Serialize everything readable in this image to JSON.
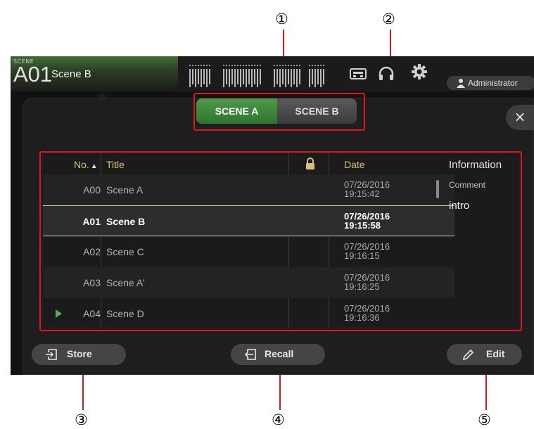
{
  "callouts": [
    "①",
    "②",
    "③",
    "④",
    "⑤"
  ],
  "topbar": {
    "scene_label": "SCENE",
    "scene_number": "A01",
    "scene_name": "Scene B",
    "user_label": "Administrator"
  },
  "scene_switch": {
    "a_label": "SCENE A",
    "b_label": "SCENE B",
    "active": "SCENE A"
  },
  "close_label": "×",
  "table": {
    "headers": {
      "number": "No.",
      "sort_indicator": "▲",
      "title": "Title",
      "date": "Date"
    },
    "rows": [
      {
        "number": "A00",
        "title": "Scene A",
        "date": "07/26/2016",
        "time": "19:15:42"
      },
      {
        "number": "A01",
        "title": "Scene B",
        "date": "07/26/2016",
        "time": "19:15:58"
      },
      {
        "number": "A02",
        "title": "Scene C",
        "date": "07/26/2016",
        "time": "19:16:15"
      },
      {
        "number": "A03",
        "title": "Scene A'",
        "date": "07/26/2016",
        "time": "19:16:25"
      },
      {
        "number": "A04",
        "title": "Scene D",
        "date": "07/26/2016",
        "time": "19:16:36"
      }
    ],
    "selected": "A01",
    "current": "A04"
  },
  "information": {
    "header": "Information",
    "comment_label": "Comment",
    "comment_value": "intro"
  },
  "buttons": {
    "store": "Store",
    "recall": "Recall",
    "edit": "Edit"
  },
  "colors": {
    "accent_green": "#3f8f3d",
    "header_gold": "#d8c27a",
    "callout_red": "#e0161b"
  }
}
